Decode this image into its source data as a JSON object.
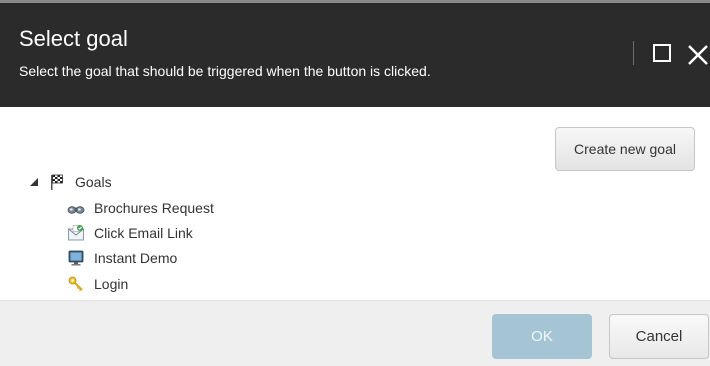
{
  "dialog": {
    "title": "Select goal",
    "subtitle": "Select the goal that should be triggered when the button is clicked."
  },
  "toolbar": {
    "create_label": "Create new goal"
  },
  "tree": {
    "root": {
      "label": "Goals",
      "icon": "checkered-flag-icon",
      "expanded": true
    },
    "items": [
      {
        "label": "Brochures Request",
        "icon": "binoculars-icon"
      },
      {
        "label": "Click Email Link",
        "icon": "email-icon"
      },
      {
        "label": "Instant Demo",
        "icon": "monitor-icon"
      },
      {
        "label": "Login",
        "icon": "key-icon"
      }
    ]
  },
  "footer": {
    "ok_label": "OK",
    "cancel_label": "Cancel"
  },
  "colors": {
    "header_bg": "#2b2b2b",
    "footer_bg": "#efefef",
    "ok_disabled": "#a5c4d4"
  }
}
